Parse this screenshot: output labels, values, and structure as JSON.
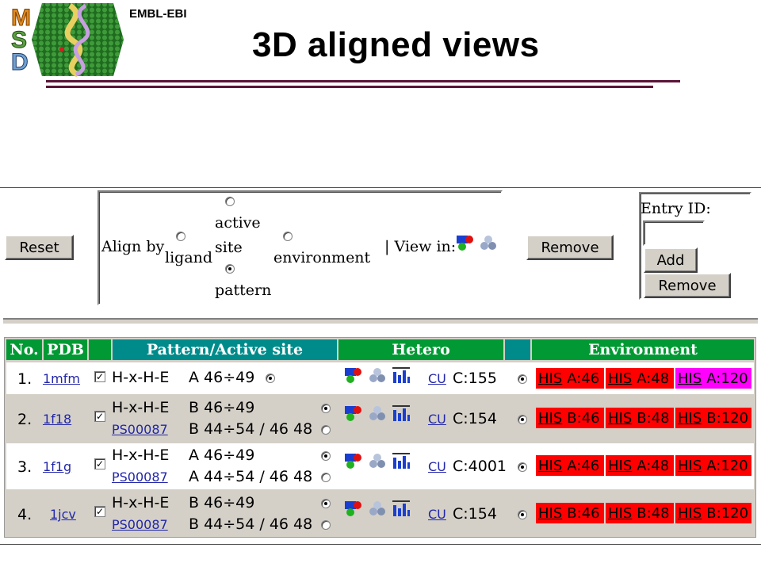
{
  "header": {
    "org": "EMBL-EBI",
    "title": "3D aligned views",
    "logo_letters": [
      "M",
      "S",
      "D"
    ]
  },
  "controls": {
    "reset": "Reset",
    "align_by": "Align by",
    "opt_ligand": "ligand",
    "opt_active1": "active",
    "opt_active2": "site",
    "opt_pattern": "pattern",
    "opt_environment": "environment",
    "view_in": "| View in:",
    "remove": "Remove",
    "entry_id": "Entry ID:",
    "add": "Add",
    "remove2": "Remove"
  },
  "table": {
    "headers": [
      "No.",
      "PDB",
      "Pattern/Active site",
      "Hetero",
      "Environment"
    ],
    "rows": [
      {
        "no": "1.",
        "pdb": "1mfm",
        "checked": true,
        "patterns": [
          {
            "name": "H-x-H-E",
            "range": "A 46÷49",
            "selected": true
          }
        ],
        "prosite": "",
        "prosite_range": "",
        "het_link": "CU",
        "het_loc": "C:155",
        "env": [
          {
            "res": "HIS",
            "loc": "A:46",
            "color": "#ff0000"
          },
          {
            "res": "HIS",
            "loc": "A:48",
            "color": "#ff0000"
          },
          {
            "res": "HIS",
            "loc": "A:120",
            "color": "#ff00ff"
          }
        ]
      },
      {
        "no": "2.",
        "pdb": "1f18",
        "checked": true,
        "patterns": [
          {
            "name": "H-x-H-E",
            "range": "B 46÷49",
            "selected": true
          }
        ],
        "prosite": "PS00087",
        "prosite_range": "B 44÷54 / 46 48",
        "het_link": "CU",
        "het_loc": "C:154",
        "env": [
          {
            "res": "HIS",
            "loc": "B:46",
            "color": "#ff0000"
          },
          {
            "res": "HIS",
            "loc": "B:48",
            "color": "#ff0000"
          },
          {
            "res": "HIS",
            "loc": "B:120",
            "color": "#ff0000"
          }
        ]
      },
      {
        "no": "3.",
        "pdb": "1f1g",
        "checked": true,
        "patterns": [
          {
            "name": "H-x-H-E",
            "range": "A 46÷49",
            "selected": true
          }
        ],
        "prosite": "PS00087",
        "prosite_range": "A 44÷54 / 46 48",
        "het_link": "CU",
        "het_loc": "C:4001",
        "env": [
          {
            "res": "HIS",
            "loc": "A:46",
            "color": "#ff0000"
          },
          {
            "res": "HIS",
            "loc": "A:48",
            "color": "#ff0000"
          },
          {
            "res": "HIS",
            "loc": "A:120",
            "color": "#ff0000"
          }
        ]
      },
      {
        "no": "4.",
        "pdb": "1jcv",
        "checked": true,
        "patterns": [
          {
            "name": "H-x-H-E",
            "range": "B 46÷49",
            "selected": true
          }
        ],
        "prosite": "PS00087",
        "prosite_range": "B 44÷54 / 46 48",
        "het_link": "CU",
        "het_loc": "C:154",
        "env": [
          {
            "res": "HIS",
            "loc": "B:46",
            "color": "#ff0000"
          },
          {
            "res": "HIS",
            "loc": "B:48",
            "color": "#ff0000"
          },
          {
            "res": "HIS",
            "loc": "B:120",
            "color": "#ff0000"
          }
        ]
      }
    ]
  },
  "colors": {
    "header_teal": "#008b8b",
    "header_green": "#009933",
    "rule": "#5b1437",
    "row_white": "#ffffff",
    "row_gray": "#d4d0c8"
  }
}
